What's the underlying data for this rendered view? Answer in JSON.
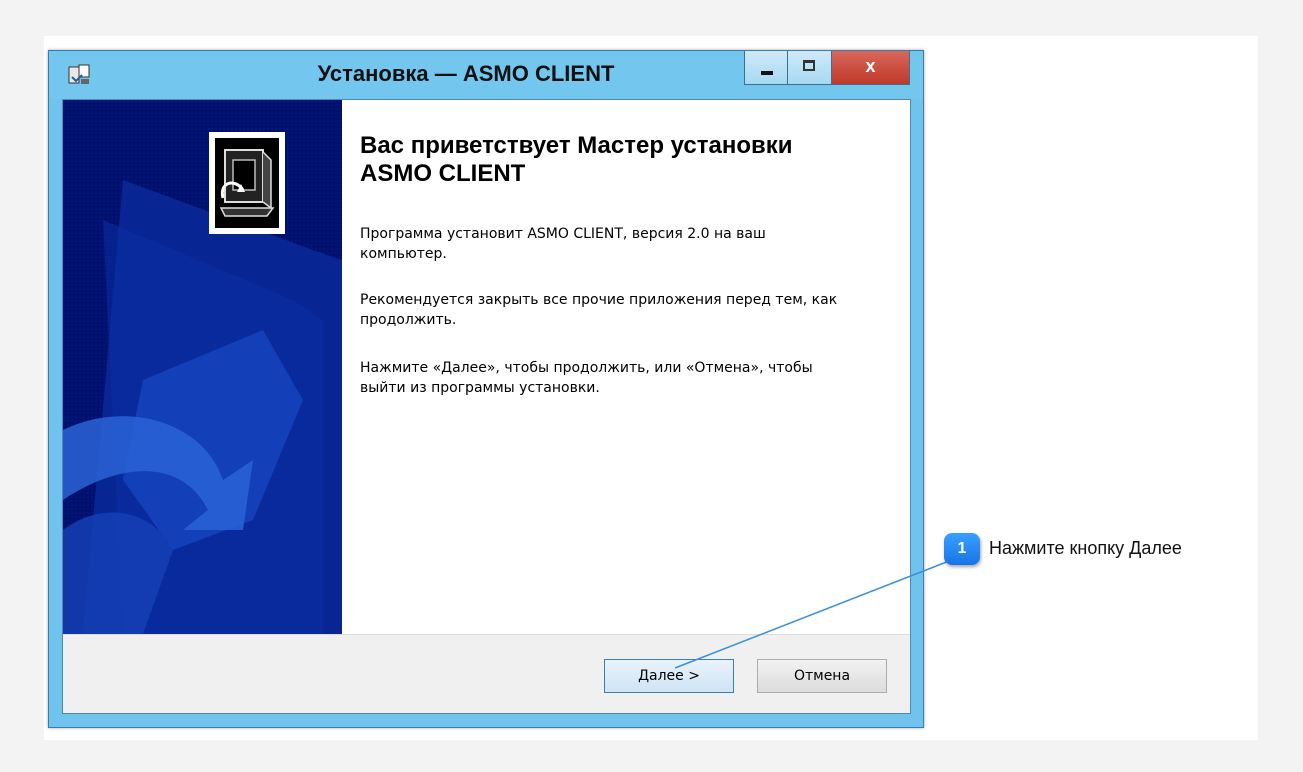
{
  "window": {
    "title": "Установка — ASMO CLIENT",
    "icons": {
      "app": "installer-icon",
      "minimize": "minimize-icon",
      "maximize": "maximize-icon",
      "close": "close-icon"
    },
    "close_glyph": "x"
  },
  "content": {
    "heading": "Вас приветствует Мастер установки ASMO CLIENT",
    "paragraph1": "Программа установит ASMO CLIENT, версия 2.0 на ваш компьютер.",
    "paragraph2": "Рекомендуется закрыть все прочие приложения перед тем, как продолжить.",
    "paragraph3": "Нажмите «Далее», чтобы продолжить, или «Отмена», чтобы выйти из программы установки."
  },
  "buttons": {
    "next": "Далее >",
    "cancel": "Отмена"
  },
  "annotation": {
    "number": "1",
    "text": "Нажмите кнопку Далее"
  },
  "colors": {
    "sidebar": "#00106b",
    "title_bar": "#73c6ee",
    "close_button": "#c0392b",
    "badge": "#1774e6"
  }
}
